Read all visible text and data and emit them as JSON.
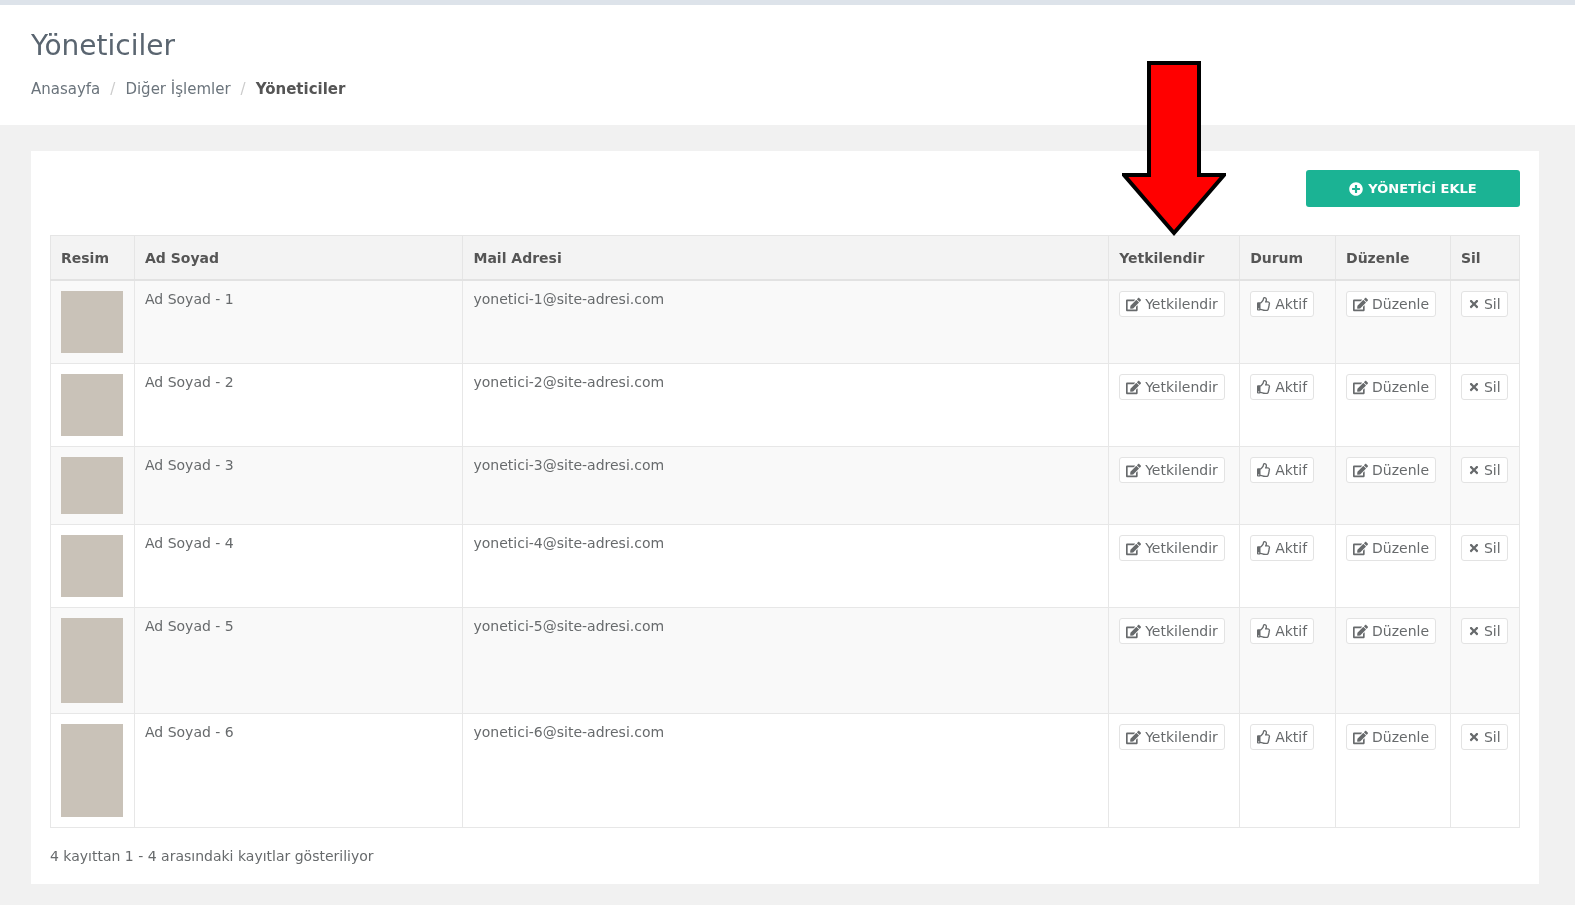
{
  "page_title": "Yöneticiler",
  "breadcrumb": [
    {
      "label": "Anasayfa",
      "selected": false
    },
    {
      "label": "Diğer İşlemler",
      "selected": false
    },
    {
      "label": "Yöneticiler",
      "selected": true
    }
  ],
  "breadcrumb_separator": "/",
  "add_button": {
    "label": "YÖNETİCİ EKLE"
  },
  "table": {
    "columns": [
      "Resim",
      "Ad Soyad",
      "Mail Adresi",
      "Yetkilendir",
      "Durum",
      "Düzenle",
      "Sil"
    ],
    "rows": [
      {
        "name": "Ad Soyad - 1",
        "email": "yonetici-1@site-adresi.com",
        "authorize": "Yetkilendir",
        "status": "Aktif",
        "edit": "Düzenle",
        "delete": "Sil"
      },
      {
        "name": "Ad Soyad - 2",
        "email": "yonetici-2@site-adresi.com",
        "authorize": "Yetkilendir",
        "status": "Aktif",
        "edit": "Düzenle",
        "delete": "Sil"
      },
      {
        "name": "Ad Soyad - 3",
        "email": "yonetici-3@site-adresi.com",
        "authorize": "Yetkilendir",
        "status": "Aktif",
        "edit": "Düzenle",
        "delete": "Sil"
      },
      {
        "name": "Ad Soyad - 4",
        "email": "yonetici-4@site-adresi.com",
        "authorize": "Yetkilendir",
        "status": "Aktif",
        "edit": "Düzenle",
        "delete": "Sil"
      },
      {
        "name": "Ad Soyad - 5",
        "email": "yonetici-5@site-adresi.com",
        "authorize": "Yetkilendir",
        "status": "Aktif",
        "edit": "Düzenle",
        "delete": "Sil"
      },
      {
        "name": "Ad Soyad - 6",
        "email": "yonetici-6@site-adresi.com",
        "authorize": "Yetkilendir",
        "status": "Aktif",
        "edit": "Düzenle",
        "delete": "Sil"
      }
    ]
  },
  "footer_info": "4 kayıttan 1 - 4 arasındaki kayıtlar gösteriliyor"
}
